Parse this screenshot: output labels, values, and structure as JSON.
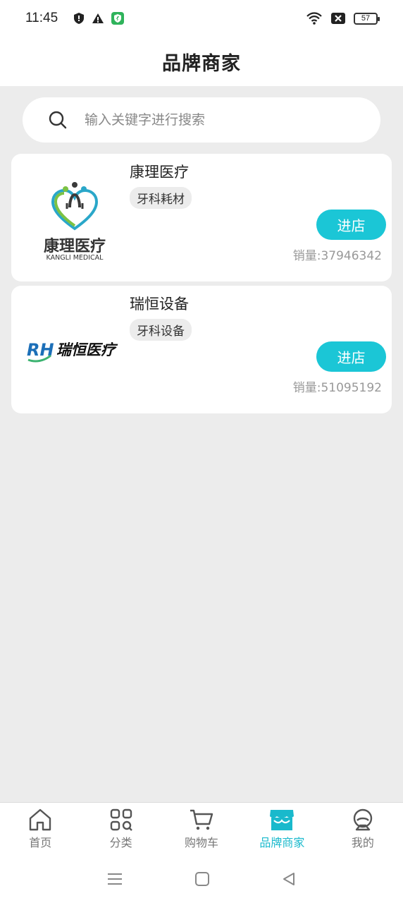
{
  "status": {
    "time": "11:45",
    "battery": "57"
  },
  "header": {
    "title": "品牌商家"
  },
  "search": {
    "placeholder": "输入关键字进行搜索",
    "value": ""
  },
  "brands": [
    {
      "name": "康理医疗",
      "tag": "牙科耗材",
      "enter_label": "进店",
      "sales": "销量:37946342",
      "logo_text_cn": "康理医疗",
      "logo_text_en": "KANGLI MEDICAL"
    },
    {
      "name": "瑞恒设备",
      "tag": "牙科设备",
      "enter_label": "进店",
      "sales": "销量:51095192",
      "logo_text_cn": "瑞恒医疗",
      "logo_mark": "RH"
    }
  ],
  "tabbar": {
    "items": [
      {
        "label": "首页",
        "icon": "home-icon"
      },
      {
        "label": "分类",
        "icon": "category-icon"
      },
      {
        "label": "购物车",
        "icon": "cart-icon"
      },
      {
        "label": "品牌商家",
        "icon": "store-icon",
        "active": true
      },
      {
        "label": "我的",
        "icon": "profile-icon"
      }
    ]
  },
  "colors": {
    "accent": "#1bc6d6",
    "active_tab": "#19b9cc",
    "background": "#ececec"
  }
}
